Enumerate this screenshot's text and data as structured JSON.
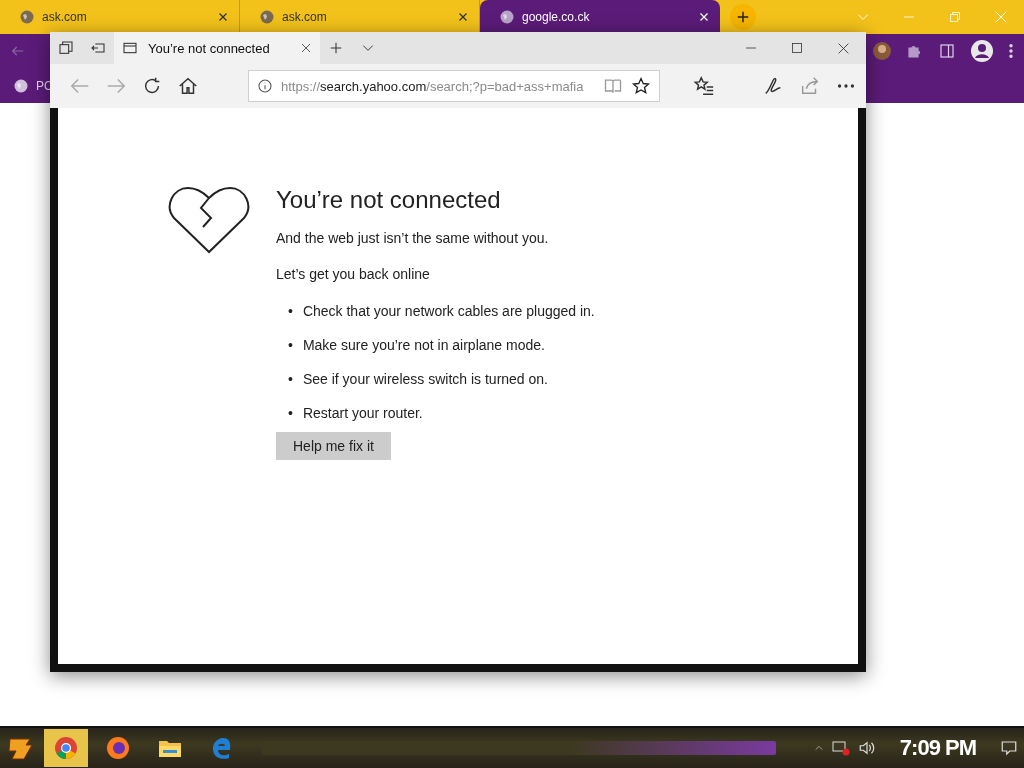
{
  "chrome": {
    "tabs": [
      {
        "title": "ask.com",
        "selected": false
      },
      {
        "title": "ask.com",
        "selected": false
      },
      {
        "title": "google.co.ck",
        "selected": true
      }
    ],
    "bookmark": "PC"
  },
  "edge": {
    "tab": {
      "title": "You’re not connected",
      "selected": true
    },
    "address": {
      "scheme": "https://",
      "host": "search.yahoo.com",
      "path": "/search;?p=bad+ass+mafia"
    },
    "error": {
      "title": "You’re not connected",
      "subtitle": "And the web just isn’t the same without you.",
      "prompt": "Let’s get you back online",
      "tips": [
        {
          "bullet": "•",
          "text": "Check that your network cables are plugged in."
        },
        {
          "bullet": "•",
          "text": "Make sure you’re not in airplane mode."
        },
        {
          "bullet": "•",
          "text": "See if your wireless switch is turned on."
        },
        {
          "bullet": "•",
          "text": "Restart your router."
        }
      ],
      "button": "Help me fix it"
    }
  },
  "taskbar": {
    "apps": [
      {
        "kind": "chrome",
        "active": true
      },
      {
        "kind": "firefox",
        "active": false
      },
      {
        "kind": "folder",
        "active": false
      },
      {
        "kind": "edge",
        "active": false
      }
    ],
    "clock": "7:09 PM"
  }
}
